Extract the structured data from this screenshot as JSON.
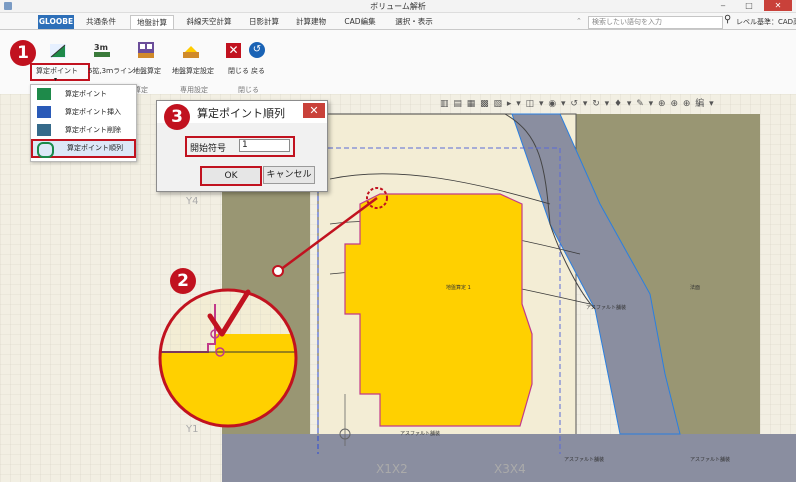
{
  "window": {
    "title": "ボリューム解析"
  },
  "menu": {
    "tabs": [
      "GLOOBE",
      "共通条件",
      "地盤計算",
      "斜線天空計算",
      "日影計算",
      "計算建物",
      "CAD編集",
      "選択・表示"
    ],
    "active_tab": "地盤計算",
    "search_placeholder": "検索したい語句を入力",
    "level_label": "レベル基準：CAD高基準"
  },
  "ribbon": {
    "btn_point": "算定ポイント",
    "btn_3m": "3m",
    "btn_3m_line": "5拡,3ｍライン",
    "btn_ground_calc": "地盤算定",
    "btn_ground_setting": "地盤算定設定",
    "btn_close": "閉じる",
    "btn_back": "戻る",
    "group_ground": "地盤算定",
    "group_exclusive": "専用設定",
    "group_close": "閉じる"
  },
  "dropdown": {
    "items": [
      "算定ポイント",
      "算定ポイント挿入",
      "算定ポイント削除",
      "算定ポイント順列"
    ]
  },
  "dialog": {
    "title": "算定ポイント順列",
    "field_label": "開始符号",
    "field_value": "1",
    "ok": "OK",
    "cancel": "キャンセル"
  },
  "canvas": {
    "grid_labels": [
      "Y4",
      "Y1",
      "X1X2",
      "X3X4"
    ],
    "building_label": "地盤算定 1",
    "asphalt_labels": [
      "アスファルト舗装",
      "アスファルト舗装",
      "アスファルト舗装",
      "アスファルト舗装"
    ],
    "slope_label": "法面"
  },
  "callouts": [
    "1",
    "2",
    "3"
  ],
  "colors": {
    "accent": "#c1121f",
    "building": "#ffd000",
    "road": "#8a8ea0",
    "lawn": "#999673",
    "ribbon_file_tab": "#2d6fb8"
  }
}
